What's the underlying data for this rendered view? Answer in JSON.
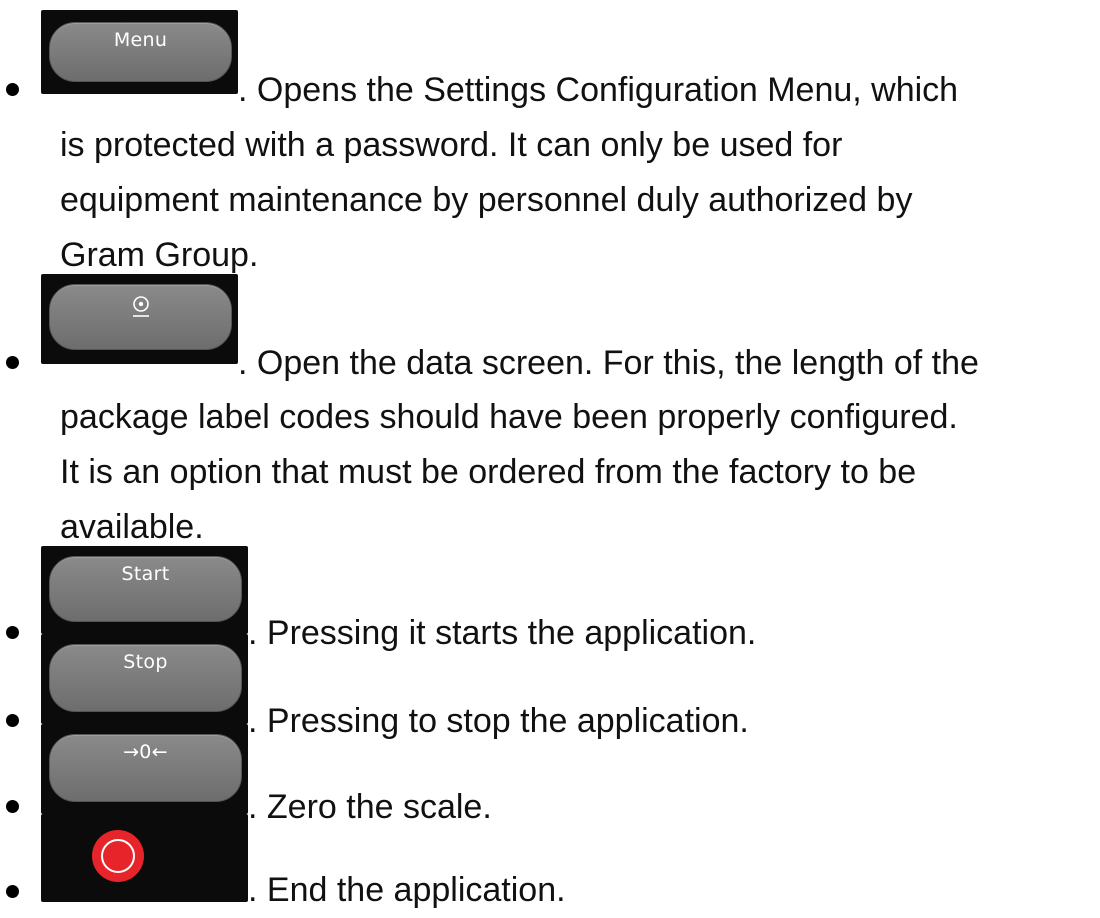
{
  "items": [
    {
      "button_label": "Menu",
      "line1": ". Opens the Settings Configuration Menu, which",
      "line2": "is protected with a password. It can only be used for",
      "line3": "equipment maintenance by personnel duly authorized by",
      "line4": "Gram Group."
    },
    {
      "button_icon": "disc-icon",
      "line1": ". Open the data screen. For this, the length of the",
      "line2": "package label codes should have been properly configured.",
      "line3": "It is an option that must be ordered from the factory to be",
      "line4": "available."
    },
    {
      "button_label": "Start",
      "line1": ". Pressing it starts the application."
    },
    {
      "button_label": "Stop",
      "line1": ". Pressing to stop the application."
    },
    {
      "button_label": "→0←",
      "line1": ". Zero the scale."
    },
    {
      "button_icon": "record-icon",
      "button_color": "#e8242b",
      "line1": ". End the application."
    }
  ]
}
